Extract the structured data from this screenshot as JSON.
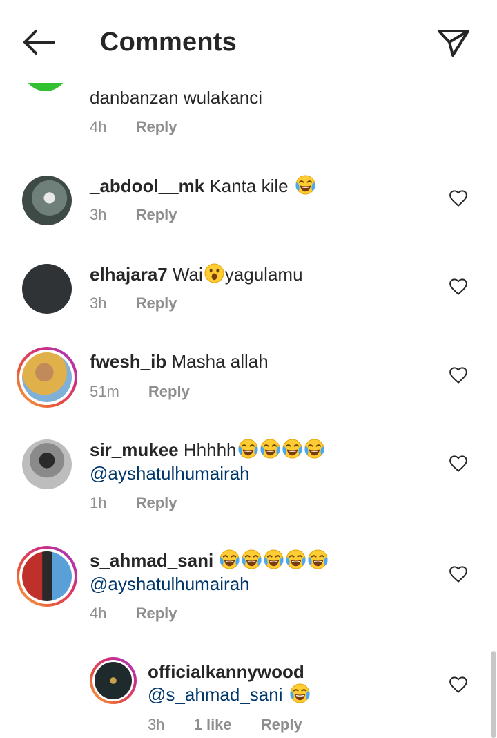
{
  "header": {
    "title": "Comments",
    "back_icon": "arrow-left-icon",
    "send_icon": "paper-plane-icon"
  },
  "comments": [
    {
      "text": "danbanzan wulakanci",
      "time": "4h",
      "reply": "Reply"
    },
    {
      "username": "_abdool__mk",
      "text": "Kanta kile",
      "emoji": "tears-of-joy",
      "time": "3h",
      "reply": "Reply"
    },
    {
      "username": "elhajara7",
      "text_before": "Wai",
      "emoji": "astonished",
      "text_after": "yagulamu",
      "time": "3h",
      "reply": "Reply"
    },
    {
      "username": "fwesh_ib",
      "text": "Masha allah",
      "time": "51m",
      "reply": "Reply"
    },
    {
      "username": "sir_mukee",
      "text": "Hhhhh",
      "emoji_count": 4,
      "mention": "@ayshatulhumairah",
      "time": "1h",
      "reply": "Reply"
    },
    {
      "username": "s_ahmad_sani",
      "emoji_count": 5,
      "mention": "@ayshatulhumairah",
      "time": "4h",
      "reply": "Reply"
    },
    {
      "username": "officialkannywood",
      "mention": "@s_ahmad_sani",
      "emoji": "tears-of-joy",
      "time": "3h",
      "likes": "1 like",
      "reply": "Reply"
    }
  ],
  "colors": {
    "text": "#262626",
    "meta": "#8e8e8e",
    "mention": "#00376b",
    "ring_start": "#f9b242",
    "ring_end": "#9a3ad1"
  }
}
